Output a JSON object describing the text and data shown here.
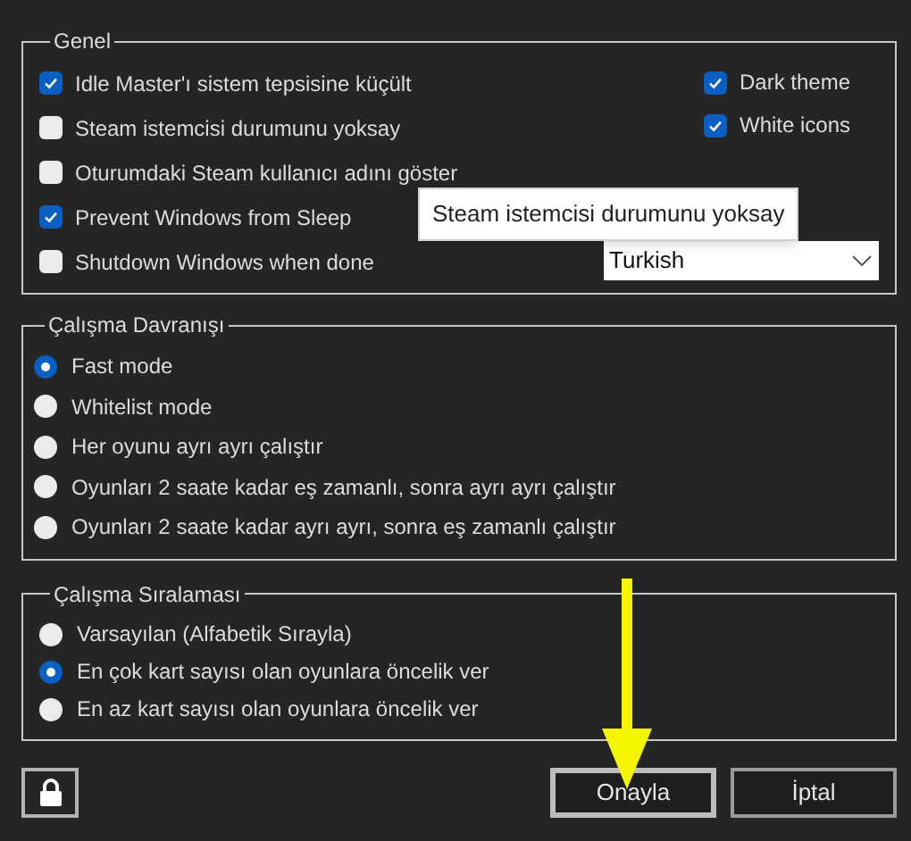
{
  "general": {
    "title": "Genel",
    "options": [
      {
        "label": "Idle Master'ı sistem tepsisine küçült",
        "checked": true
      },
      {
        "label": "Steam istemcisi durumunu yoksay",
        "checked": false
      },
      {
        "label": "Oturumdaki Steam kullanıcı adını göster",
        "checked": false
      },
      {
        "label": "Prevent Windows from Sleep",
        "checked": true
      },
      {
        "label": "Shutdown Windows when done",
        "checked": false
      }
    ],
    "display_options": [
      {
        "label": "Dark theme",
        "checked": true
      },
      {
        "label": "White icons",
        "checked": true
      }
    ],
    "language_dropdown": {
      "value": "Turkish"
    }
  },
  "behavior": {
    "title": "Çalışma Davranışı",
    "options": [
      {
        "label": "Fast mode",
        "selected": true
      },
      {
        "label": "Whitelist mode",
        "selected": false
      },
      {
        "label": "Her oyunu ayrı ayrı çalıştır",
        "selected": false
      },
      {
        "label": "Oyunları 2 saate kadar eş zamanlı, sonra ayrı ayrı çalıştır",
        "selected": false
      },
      {
        "label": "Oyunları 2 saate kadar ayrı ayrı, sonra eş zamanlı çalıştır",
        "selected": false
      }
    ]
  },
  "order": {
    "title": "Çalışma Sıralaması",
    "options": [
      {
        "label": "Varsayılan (Alfabetik Sırayla)",
        "selected": false
      },
      {
        "label": "En çok kart sayısı olan oyunlara öncelik ver",
        "selected": true
      },
      {
        "label": "En az kart sayısı olan oyunlara öncelik ver",
        "selected": false
      }
    ]
  },
  "tooltip": {
    "text": "Steam istemcisi durumunu yoksay"
  },
  "buttons": [
    {
      "label": "Onayla",
      "kind": "default"
    },
    {
      "label": "İptal",
      "kind": "normal"
    }
  ]
}
